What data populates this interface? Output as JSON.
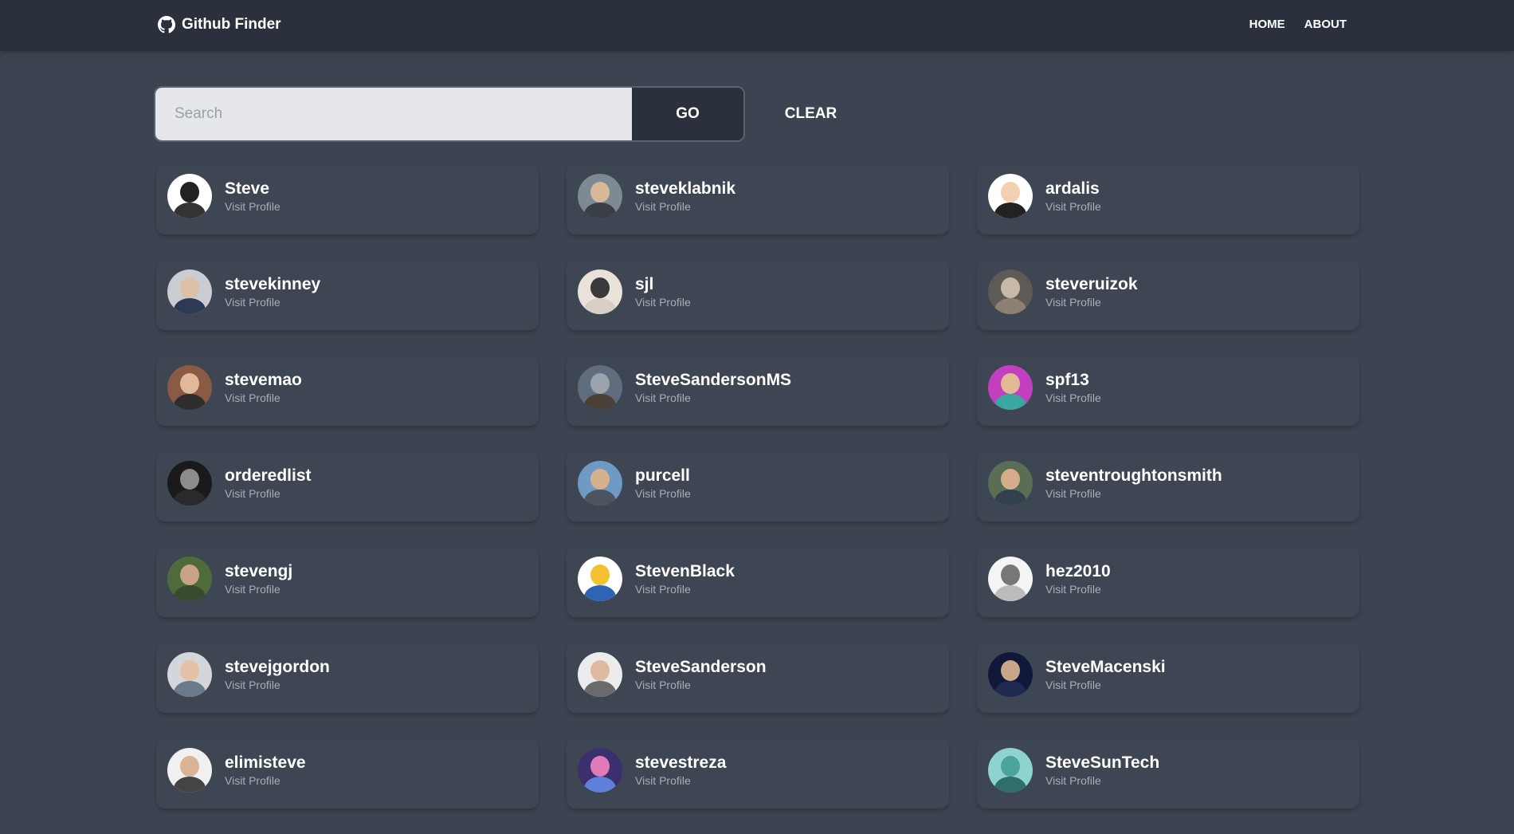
{
  "header": {
    "brand": "Github Finder",
    "nav": [
      {
        "label": "HOME"
      },
      {
        "label": "ABOUT"
      }
    ]
  },
  "search": {
    "placeholder": "Search",
    "value": "",
    "go_label": "GO",
    "clear_label": "CLEAR"
  },
  "users": [
    {
      "login": "Steve",
      "link": "Visit Profile",
      "bg": "#ffffff",
      "head": "#222222",
      "body": "#333333"
    },
    {
      "login": "steveklabnik",
      "link": "Visit Profile",
      "bg": "#7d8a94",
      "head": "#d9b89a",
      "body": "#3a3f46"
    },
    {
      "login": "ardalis",
      "link": "Visit Profile",
      "bg": "#ffffff",
      "head": "#f2d0b0",
      "body": "#222222"
    },
    {
      "login": "stevekinney",
      "link": "Visit Profile",
      "bg": "#c9ccd1",
      "head": "#e0bfa8",
      "body": "#2c3a55"
    },
    {
      "login": "sjl",
      "link": "Visit Profile",
      "bg": "#e9e2da",
      "head": "#3a3a3a",
      "body": "#d8cfc6"
    },
    {
      "login": "steveruizok",
      "link": "Visit Profile",
      "bg": "#5e5a55",
      "head": "#c8b8a8",
      "body": "#8d8072"
    },
    {
      "login": "stevemao",
      "link": "Visit Profile",
      "bg": "#8a5a45",
      "head": "#e0b99a",
      "body": "#2d2d2d"
    },
    {
      "login": "SteveSandersonMS",
      "link": "Visit Profile",
      "bg": "#5f6d7e",
      "head": "#9aa3ad",
      "body": "#4b4037"
    },
    {
      "login": "spf13",
      "link": "Visit Profile",
      "bg": "#c23fbf",
      "head": "#e3b894",
      "body": "#3aa7a0"
    },
    {
      "login": "orderedlist",
      "link": "Visit Profile",
      "bg": "#1a1a1a",
      "head": "#8c8c8c",
      "body": "#2a2a2a"
    },
    {
      "login": "purcell",
      "link": "Visit Profile",
      "bg": "#6f9ac4",
      "head": "#d7b08e",
      "body": "#4a5560"
    },
    {
      "login": "steventroughtonsmith",
      "link": "Visit Profile",
      "bg": "#5a6d55",
      "head": "#d6ad8b",
      "body": "#33414f"
    },
    {
      "login": "stevengj",
      "link": "Visit Profile",
      "bg": "#4f6b3c",
      "head": "#c9a386",
      "body": "#3a4a2e"
    },
    {
      "login": "StevenBlack",
      "link": "Visit Profile",
      "bg": "#ffffff",
      "head": "#f2c230",
      "body": "#2e63b5"
    },
    {
      "login": "hez2010",
      "link": "Visit Profile",
      "bg": "#f4f4f4",
      "head": "#777777",
      "body": "#bbbbbb"
    },
    {
      "login": "stevejgordon",
      "link": "Visit Profile",
      "bg": "#d3d6da",
      "head": "#e4c2a6",
      "body": "#6b7b8c"
    },
    {
      "login": "SteveSanderson",
      "link": "Visit Profile",
      "bg": "#ececec",
      "head": "#dfbaa0",
      "body": "#6a6a6a"
    },
    {
      "login": "SteveMacenski",
      "link": "Visit Profile",
      "bg": "#10183a",
      "head": "#c9a58a",
      "body": "#202a4f"
    },
    {
      "login": "elimisteve",
      "link": "Visit Profile",
      "bg": "#f0f0f0",
      "head": "#d9b394",
      "body": "#444444"
    },
    {
      "login": "stevestreza",
      "link": "Visit Profile",
      "bg": "#3c2f6e",
      "head": "#e07ab8",
      "body": "#5f7fd8"
    },
    {
      "login": "SteveSunTech",
      "link": "Visit Profile",
      "bg": "#8fd3d0",
      "head": "#4ba39e",
      "body": "#2f6f6b"
    }
  ]
}
